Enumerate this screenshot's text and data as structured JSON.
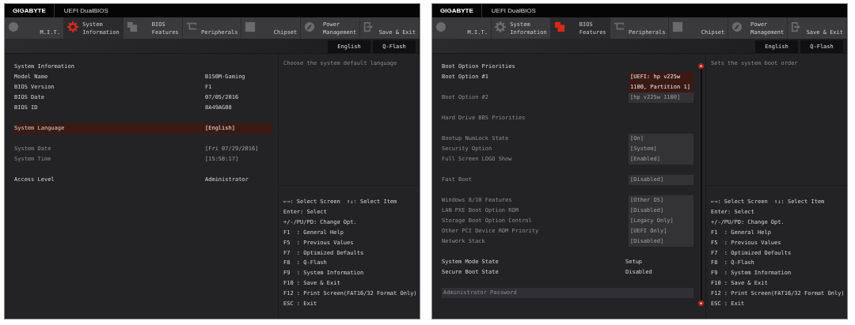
{
  "screens": [
    {
      "brand": "GIGABYTE",
      "product": "UEFI DualBIOS",
      "tabs": [
        {
          "lines": [
            "M.I.T."
          ],
          "selected": false
        },
        {
          "lines": [
            "System",
            "Information"
          ],
          "selected": true
        },
        {
          "lines": [
            "BIOS",
            "Features"
          ],
          "selected": false
        },
        {
          "lines": [
            "Peripherals"
          ],
          "selected": false
        },
        {
          "lines": [
            "Chipset"
          ],
          "selected": false
        },
        {
          "lines": [
            "Power",
            "Management"
          ],
          "selected": false
        },
        {
          "lines": [
            "Save & Exit"
          ],
          "selected": false
        }
      ],
      "top_buttons": [
        "English",
        "Q-Flash"
      ],
      "groups": [
        [
          {
            "kind": "heading",
            "label": "System Information",
            "disabled": false,
            "selected": false
          },
          {
            "kind": "value",
            "label": "Model Name",
            "value": "B150M-Gaming",
            "disabled": false,
            "selected": false
          },
          {
            "kind": "value",
            "label": "BIOS Version",
            "value": "F1",
            "disabled": false,
            "selected": false
          },
          {
            "kind": "value",
            "label": "BIOS Date",
            "value": "07/05/2016",
            "disabled": false,
            "selected": false
          },
          {
            "kind": "value",
            "label": "BIOS ID",
            "value": "8A49AG08",
            "disabled": false,
            "selected": false
          }
        ],
        [
          {
            "kind": "value",
            "label": "System Language",
            "value": "[English]",
            "disabled": false,
            "selected": true
          }
        ],
        [
          {
            "kind": "value",
            "label": "System Date",
            "value": "[Fri 07/29/2016]",
            "disabled": true,
            "selected": false
          },
          {
            "kind": "value",
            "label": "System Time",
            "value": "[15:58:17]",
            "disabled": true,
            "selected": false
          }
        ],
        [
          {
            "kind": "value",
            "label": "Access Level",
            "value": "Administrator",
            "disabled": false,
            "selected": false
          }
        ]
      ],
      "scrollbar": false,
      "help": "Choose the system default language",
      "legend": [
        "←→: Select Screen  ↑↓: Select Item",
        "Enter: Select",
        "+/-/PU/PD: Change Opt.",
        "F1  : General Help",
        "F5  : Previous Values",
        "F7  : Optimized Defaults",
        "F8  : Q-Flash",
        "F9  : System Information",
        "F10 : Save & Exit",
        "F12 : Print Screen(FAT16/32 Format Only)",
        "ESC : Exit"
      ]
    },
    {
      "brand": "GIGABYTE",
      "product": "UEFI DualBIOS",
      "tabs": [
        {
          "lines": [
            "M.I.T."
          ],
          "selected": false
        },
        {
          "lines": [
            "System",
            "Information"
          ],
          "selected": false
        },
        {
          "lines": [
            "BIOS",
            "Features"
          ],
          "selected": true
        },
        {
          "lines": [
            "Peripherals"
          ],
          "selected": false
        },
        {
          "lines": [
            "Chipset"
          ],
          "selected": false
        },
        {
          "lines": [
            "Power",
            "Management"
          ],
          "selected": false
        },
        {
          "lines": [
            "Save & Exit"
          ],
          "selected": false
        }
      ],
      "top_buttons": [
        "English",
        "Q-Flash"
      ],
      "groups": [
        [
          {
            "kind": "heading",
            "label": "Boot Option Priorities",
            "disabled": false,
            "selected": false
          },
          {
            "kind": "option",
            "label": "Boot Option #1",
            "value": "[UEFI: hp v225w 1100, Partition 1]",
            "disabled": false,
            "selected": true
          },
          {
            "kind": "option",
            "label": "Boot Option #2",
            "value": "[hp v225w 1100]",
            "disabled": true,
            "selected": false
          }
        ],
        [
          {
            "kind": "heading",
            "label": "Hard Drive BBS Priorities",
            "disabled": true,
            "selected": false
          }
        ],
        [
          {
            "kind": "option",
            "label": "Bootup NumLock State",
            "value": "[On]",
            "disabled": true,
            "selected": false
          },
          {
            "kind": "option",
            "label": "Security Option",
            "value": "[System]",
            "disabled": true,
            "selected": false
          },
          {
            "kind": "option",
            "label": "Full Screen LOGO Show",
            "value": "[Enabled]",
            "disabled": true,
            "selected": false
          }
        ],
        [
          {
            "kind": "option",
            "label": "Fast Boot",
            "value": "[Disabled]",
            "disabled": true,
            "selected": false
          }
        ],
        [
          {
            "kind": "option",
            "label": "Windows 8/10 Features",
            "value": "[Other OS]",
            "disabled": true,
            "selected": false
          },
          {
            "kind": "option",
            "label": "LAN PXE Boot Option ROM",
            "value": "[Disabled]",
            "disabled": true,
            "selected": false
          },
          {
            "kind": "option",
            "label": "Storage Boot Option Control",
            "value": "[Legacy Only]",
            "disabled": true,
            "selected": false
          },
          {
            "kind": "option",
            "label": "Other PCI Device ROM Priority",
            "value": "[UEFI Only]",
            "disabled": true,
            "selected": false
          },
          {
            "kind": "option",
            "label": "Network Stack",
            "value": "[Disabled]",
            "disabled": true,
            "selected": false
          }
        ],
        [
          {
            "kind": "value",
            "label": "System Mode State",
            "value": "Setup",
            "disabled": false,
            "selected": false
          },
          {
            "kind": "value",
            "label": "Secure Boot State",
            "value": "Disabled",
            "disabled": false,
            "selected": false
          }
        ],
        [
          {
            "kind": "bar",
            "label": "Administrator Password",
            "disabled": true,
            "selected": false
          }
        ]
      ],
      "scrollbar": true,
      "help": "Sets the system boot order",
      "legend": [
        "←→: Select Screen  ↑↓: Select Item",
        "Enter: Select",
        "+/-/PU/PD: Change Opt.",
        "F1  : General Help",
        "F5  : Previous Values",
        "F7  : Optimized Defaults",
        "F8  : Q-Flash",
        "F9  : System Information",
        "F10 : Save & Exit",
        "F12 : Print Screen(FAT16/32 Format Only)",
        "ESC : Exit"
      ]
    }
  ]
}
